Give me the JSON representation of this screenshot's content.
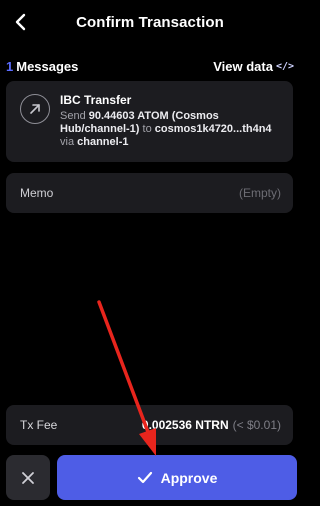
{
  "header": {
    "title": "Confirm Transaction"
  },
  "messages": {
    "count": "1",
    "label": "Messages",
    "view_data_label": "View data",
    "code_icon": "</>"
  },
  "message": {
    "icon": "arrow-up-right-icon",
    "title": "IBC Transfer",
    "send_word": "Send",
    "amount": "90.44603 ATOM (Cosmos Hub/channel-1)",
    "to_word": "to",
    "recipient": "cosmos1k4720...th4n4",
    "via_word": "via",
    "channel": "channel-1"
  },
  "memo": {
    "label": "Memo",
    "value": "(Empty)"
  },
  "fee": {
    "label": "Tx Fee",
    "amount": "0.002536 NTRN",
    "usd": "(< $0.01)"
  },
  "actions": {
    "cancel_icon": "close-icon",
    "approve_label": "Approve"
  },
  "colors": {
    "accent": "#4e5de6",
    "count_color": "#5b6cff",
    "annotation": "#e8251d"
  }
}
